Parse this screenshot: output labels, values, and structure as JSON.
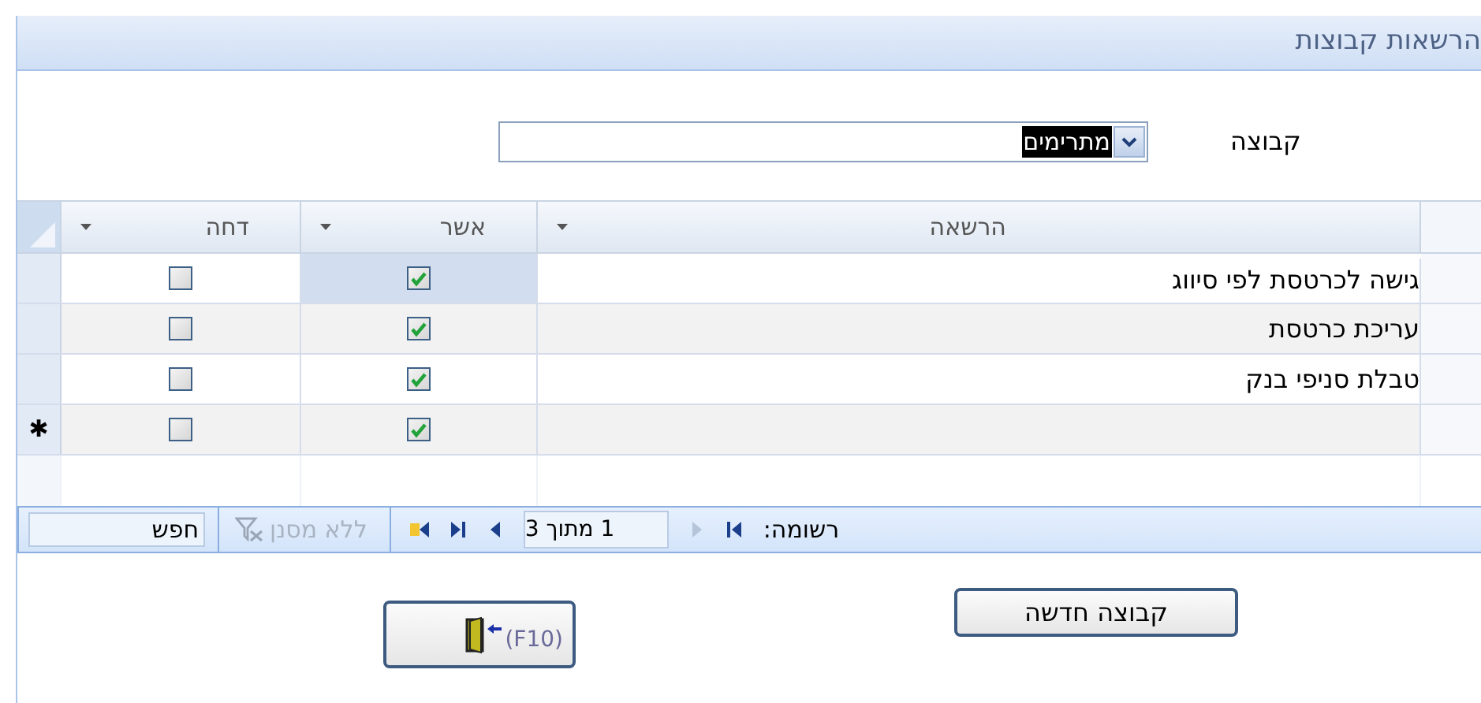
{
  "window": {
    "title": "הרשאות קבוצות"
  },
  "group_field": {
    "label": "קבוצה",
    "value": "מתרימים"
  },
  "table": {
    "columns": [
      "הרשאה",
      "אשר",
      "דחה"
    ],
    "rows": [
      {
        "kind": "record",
        "permission": "גישה לכרטסת לפי סיווג",
        "approve": true,
        "reject": false,
        "selected": true
      },
      {
        "kind": "record",
        "permission": "עריכת כרטסת",
        "approve": true,
        "reject": false,
        "selected": false
      },
      {
        "kind": "record",
        "permission": "טבלת סניפי בנק",
        "approve": true,
        "reject": false,
        "selected": false
      },
      {
        "kind": "new",
        "marker": "✱",
        "approve": true,
        "reject": false,
        "selected": false
      }
    ]
  },
  "navigator": {
    "label": "רשומה:",
    "position": "1 מתוך 3",
    "filter": "ללא מסנן",
    "filter_enabled": false,
    "search_placeholder": "חפש",
    "buttons": [
      {
        "kind": "first",
        "disabled": false
      },
      {
        "kind": "prev",
        "disabled": true
      },
      {
        "kind": "next",
        "disabled": false
      },
      {
        "kind": "last",
        "disabled": false
      },
      {
        "kind": "new",
        "disabled": false
      }
    ]
  },
  "buttons": [
    {
      "kind": "text",
      "label": "קבוצה חדשה"
    },
    {
      "kind": "exit",
      "label": "(F10)"
    }
  ]
}
